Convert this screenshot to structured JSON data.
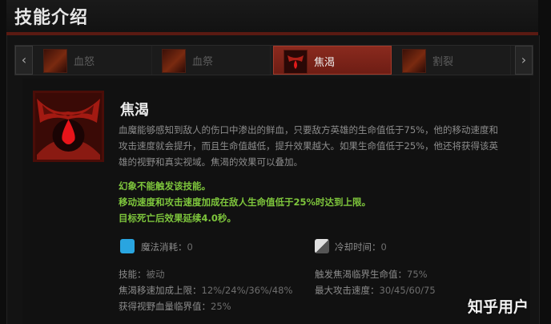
{
  "header": {
    "title": "技能介绍"
  },
  "nav": {
    "prev_label": "‹",
    "next_label": "›"
  },
  "tabs": [
    {
      "label": "血怒"
    },
    {
      "label": "血祭"
    },
    {
      "label": "焦渴"
    },
    {
      "label": "割裂"
    }
  ],
  "active_tab": "焦渴",
  "skill": {
    "name": "焦渴",
    "description": [
      "血魔能够感知到敌人的伤口中渗出的鲜血，只要敌方英雄的生命值低于75%，他的移动速度和",
      "攻击速度就会提升，而且生命值越低，提升效果越大。如果生命值低于25%，他还将获得该英",
      "雄的视野和真实视域。焦渴的效果可以叠加。"
    ],
    "notes": [
      "幻象不能触发该技能。",
      "移动速度和攻击速度加成在敌人生命值低于25%时达到上限。",
      "目标死亡后效果延续4.0秒。"
    ],
    "mana_label": "魔法消耗：",
    "mana_value": "0",
    "cooldown_label": "冷却时间：",
    "cooldown_value": "0",
    "stats": [
      {
        "label": "技能：",
        "value": "被动"
      },
      {
        "label": "触发焦渴临界生命值：",
        "value": "75%"
      },
      {
        "label": "焦渴移速加成上限：",
        "value": "12%/24%/36%/48%"
      },
      {
        "label": "最大攻击速度：",
        "value": "30/45/60/75"
      },
      {
        "label": "获得视野血量临界值：",
        "value": "25%"
      }
    ]
  },
  "watermark": "知乎用户",
  "colors": {
    "accent": "#8a2a1e",
    "note_green": "#7ec63c",
    "mana_blue": "#29a5e0"
  }
}
